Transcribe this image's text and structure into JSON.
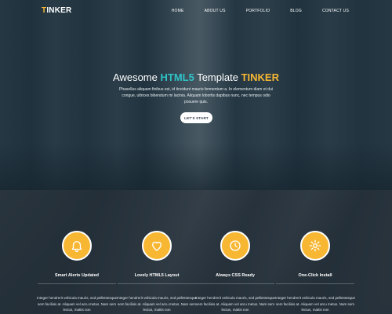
{
  "header": {
    "logo_first": "T",
    "logo_rest": "INKER",
    "nav": [
      "HOME",
      "ABOUT US",
      "PORTFOLIO",
      "BLOG",
      "CONTACT US"
    ]
  },
  "hero": {
    "title_a": "Awesome ",
    "title_b": "HTML5",
    "title_c": " Template ",
    "title_d": "TINKER",
    "text": "Phasellus aliquam finibus est, id tincidunt mauris fermentum a. In elementum diam et dui congue, ultrices bibendum mi lacinia. Aliquam lobortis dapibus nunc, nec tempus odio posuere quis.",
    "button": "LET'S START"
  },
  "features": [
    {
      "icon": "bell-icon",
      "title": "Smart Alerts Updated",
      "text": "Integer hendrerit vehicula mauris, sed pellentesque sem facilisis at. Aliquam vel arcu metus. Nam sem lectus, mattis non"
    },
    {
      "icon": "heart-icon",
      "title": "Lovely HTML5 Layout",
      "text": "Integer hendrerit vehicula mauris, sed pellentesque sem facilisis at. Aliquam vel arcu metus. Nam sem lectus, mattis non"
    },
    {
      "icon": "clock-icon",
      "title": "Always CSS Ready",
      "text": "Integer hendrerit vehicula mauris, sed pellentesque sem facilisis at. Aliquam vel arcu metus. Nam sem lectus, mattis non"
    },
    {
      "icon": "gear-icon",
      "title": "One-Click Install",
      "text": "Integer hendrerit vehicula mauris, sed pellentesque sem facilisis at. Aliquam vel arcu metus. Nam sem lectus, mattis non"
    }
  ],
  "colors": {
    "accent_gold": "#f7b733",
    "accent_teal": "#2fc3c7"
  }
}
